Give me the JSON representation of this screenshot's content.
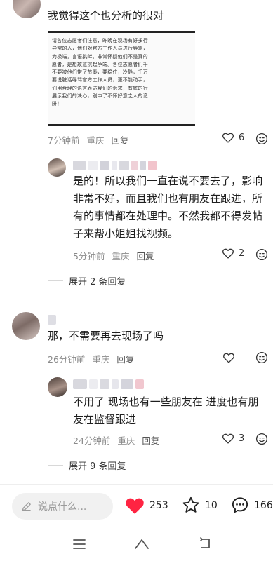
{
  "comments": [
    {
      "text": "我觉得这个也分析的很对",
      "time": "7分钟前",
      "location": "重庆",
      "reply_label": "回复",
      "likes": "6",
      "image_lines": [
        "请各位志愿者们注意，昨晚在现场有好多行",
        "异常的人，他们对官方工作人员进行辱骂，",
        "为极端，言语挑衅，非常怀疑他们不是真的",
        "愿者，是想故意挑起争端。各位志愿者们千",
        "不要被他们带了节奏，要稳住，冷静，千万",
        "要说脏话辱骂官方工作人员，更不能动手，",
        "们用合理的语言表达我们的诉求，有底的行",
        "展示我们的决心，别中了不怀好意之人的诡",
        "阱！"
      ]
    },
    {
      "text_lines": [
        "是的！所以我们一直在说不要去了，影响",
        "非常不好，而且我们也有朋友在跟进，所",
        "有的事情都在处理中。不然我都不得发帖",
        "子来帮小姐姐找视频。"
      ],
      "time": "5分钟前",
      "location": "重庆",
      "reply_label": "回复",
      "likes": "2"
    },
    {
      "text": "那，不需要再去现场了吗",
      "time": "26分钟前",
      "location": "重庆",
      "reply_label": "回复"
    },
    {
      "text_lines": [
        "不用了 现场也有一些朋友在 进度也有朋",
        "友在监督跟进"
      ],
      "time": "24分钟前",
      "location": "重庆",
      "reply_label": "回复",
      "likes": "3"
    }
  ],
  "expand_1": "展开 2 条回复",
  "expand_2": "展开 9 条回复",
  "bottom": {
    "input_placeholder": "说点什么...",
    "like_count": "253",
    "star_count": "10",
    "comment_count": "166"
  },
  "colors": {
    "like_red": "#ff2442",
    "meta_gray": "#8a8a8a"
  },
  "icons": [
    "heart-outline-icon",
    "emoji-icon",
    "pencil-icon",
    "heart-filled-icon",
    "star-outline-icon",
    "comment-icon",
    "menu-icon",
    "home-icon",
    "back-icon"
  ]
}
